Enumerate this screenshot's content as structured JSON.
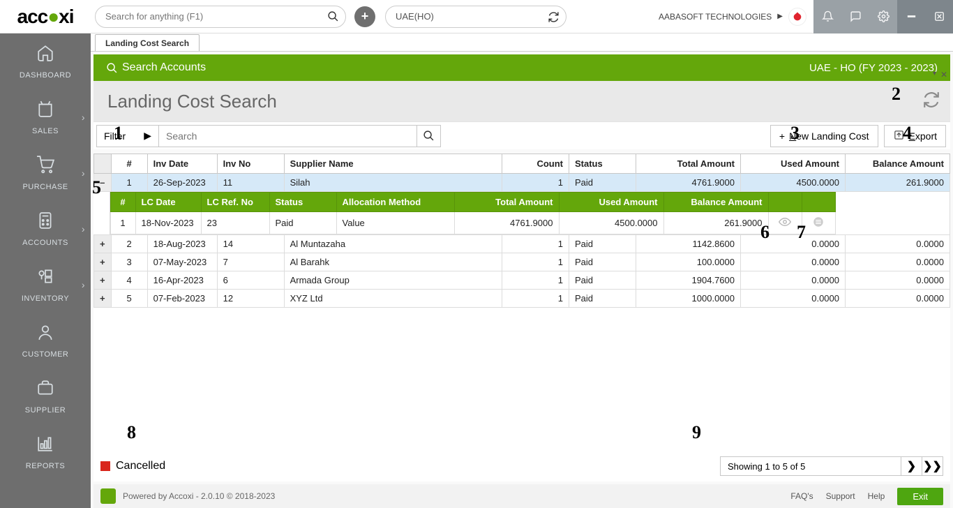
{
  "header": {
    "logo_left": "acc",
    "logo_right": "xi",
    "search_placeholder": "Search for anything (F1)",
    "location": "UAE(HO)",
    "company": "AABASOFT TECHNOLOGIES"
  },
  "sidebar": {
    "items": [
      {
        "label": "DASHBOARD",
        "icon": "home"
      },
      {
        "label": "SALES",
        "icon": "bag",
        "arrow": true
      },
      {
        "label": "PURCHASE",
        "icon": "cart",
        "arrow": true
      },
      {
        "label": "ACCOUNTS",
        "icon": "calc",
        "arrow": true
      },
      {
        "label": "INVENTORY",
        "icon": "inv",
        "arrow": true
      },
      {
        "label": "CUSTOMER",
        "icon": "user"
      },
      {
        "label": "SUPPLIER",
        "icon": "brief"
      },
      {
        "label": "REPORTS",
        "icon": "chart"
      }
    ]
  },
  "tab": {
    "label": "Landing Cost Search"
  },
  "greenband": {
    "title": "Search Accounts",
    "fy": "UAE - HO (FY 2023 - 2023)"
  },
  "page_title": "Landing Cost Search",
  "filter": {
    "label": "Filter",
    "search_placeholder": "Search",
    "new_btn": "New Landing Cost",
    "export_btn": "Export"
  },
  "columns": [
    "#",
    "Inv Date",
    "Inv No",
    "Supplier Name",
    "Count",
    "Status",
    "Total Amount",
    "Used Amount",
    "Balance Amount"
  ],
  "rows": [
    {
      "idx": 1,
      "date": "26-Sep-2023",
      "no": "11",
      "supplier": "Silah",
      "count": 1,
      "status": "Paid",
      "total": "4761.9000",
      "used": "4500.0000",
      "bal": "261.9000",
      "expanded": true
    },
    {
      "idx": 2,
      "date": "18-Aug-2023",
      "no": "14",
      "supplier": "Al Muntazaha",
      "count": 1,
      "status": "Paid",
      "total": "1142.8600",
      "used": "0.0000",
      "bal": "0.0000"
    },
    {
      "idx": 3,
      "date": "07-May-2023",
      "no": "7",
      "supplier": "Al Barahk",
      "count": 1,
      "status": "Paid",
      "total": "100.0000",
      "used": "0.0000",
      "bal": "0.0000"
    },
    {
      "idx": 4,
      "date": "16-Apr-2023",
      "no": "6",
      "supplier": "Armada Group",
      "count": 1,
      "status": "Paid",
      "total": "1904.7600",
      "used": "0.0000",
      "bal": "0.0000"
    },
    {
      "idx": 5,
      "date": "07-Feb-2023",
      "no": "12",
      "supplier": "XYZ Ltd",
      "count": 1,
      "status": "Paid",
      "total": "1000.0000",
      "used": "0.0000",
      "bal": "0.0000"
    }
  ],
  "sub_columns": [
    "#",
    "LC Date",
    "LC Ref. No",
    "Status",
    "Allocation Method",
    "Total Amount",
    "Used Amount",
    "Balance Amount"
  ],
  "sub_rows": [
    {
      "idx": 1,
      "date": "18-Nov-2023",
      "ref": "23",
      "status": "Paid",
      "method": "Value",
      "total": "4761.9000",
      "used": "4500.0000",
      "bal": "261.9000"
    }
  ],
  "legend": "Cancelled",
  "paging": "Showing 1 to 5 of 5",
  "footer": {
    "powered": "Powered by Accoxi - 2.0.10 © 2018-2023",
    "links": [
      "FAQ's",
      "Support",
      "Help"
    ],
    "exit": "Exit"
  },
  "callouts": {
    "1": "1",
    "2": "2",
    "3": "3",
    "4": "4",
    "5": "5",
    "6": "6",
    "7": "7",
    "8": "8",
    "9": "9"
  }
}
